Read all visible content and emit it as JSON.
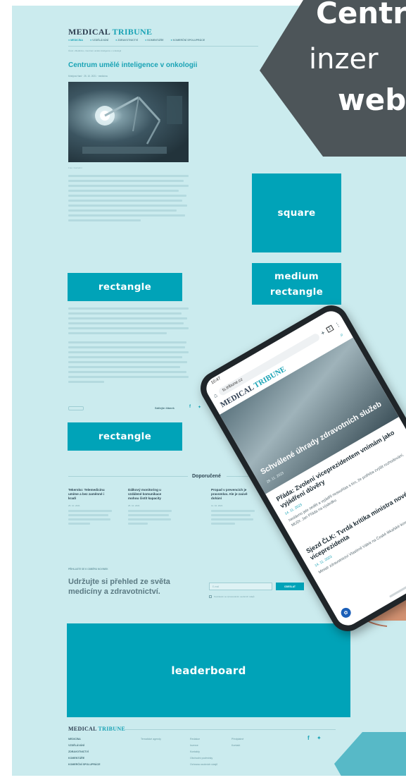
{
  "site": {
    "logo_part1": "MEDICAL",
    "logo_part2": "TRIBUNE",
    "nav": [
      "MEDICÍNA",
      "VZDĚLÁVÁNÍ",
      "ZDRAVOTNICTVÍ",
      "KOMENTÁŘE",
      "KOMERČNÍ SPOLUPRÁCE"
    ]
  },
  "article": {
    "breadcrumb": "Úvod › Medicína › Centrum umělé inteligence v onkologii",
    "title": "Centrum umělé inteligence v onkologii",
    "meta": "Kristýna Hard · 25. 10. 2021 · medicína",
    "share_label": "Sdílejte článek"
  },
  "ads": {
    "square": "square",
    "medium_rectangle": "medium rectangle",
    "rectangle_1": "rectangle",
    "rectangle_2": "rectangle",
    "leaderboard": "leaderboard"
  },
  "banner": {
    "line1": "Centr",
    "line2": "inzer",
    "line3": "web"
  },
  "recommended": {
    "heading": "Doporučené",
    "items": [
      {
        "title": "Tekersko: Telemedicínu umíme a bez zaměnné i kradí",
        "date": "25. 10. 2021"
      },
      {
        "title": "Dálkový monitoring u vzdálené komunikace mohou čistit kapacity",
        "date": "25. 10. 2021"
      },
      {
        "title": "Propad v prevencích je pravomluv. Ale je zaúvě dohání",
        "date": "11. 10. 2021"
      }
    ]
  },
  "newsletter": {
    "kicker": "PŘIHLASTE SE K ODBĚRU NOVINEK",
    "heading_line1": "Udržujte si přehled ze světa",
    "heading_line2": "medicíny a zdravotnictví.",
    "email_placeholder": "E-mail",
    "button": "ODESLAT",
    "consent": "Souhlasím se zpracováním osobních údajů"
  },
  "footer": {
    "logo_part1": "MEDICAL",
    "logo_part2": "TRIBUNE",
    "col1": [
      "MEDICÍNA",
      "VZDĚLÁVÁNÍ",
      "ZDRAVOTNICTVÍ",
      "KOMENTÁŘE",
      "KOMERČNÍ SPOLUPRÁCE"
    ],
    "col2": [
      "Tematické agendy"
    ],
    "col3": [
      "Redakce",
      "Inzerce",
      "Kontakty",
      "Obchodní podmínky",
      "Ochrana osobních údajů"
    ],
    "col4": [
      "Předplatné",
      "Kontakt"
    ]
  },
  "phone": {
    "url": "ts.tribune.cz",
    "tabs_count": "1",
    "logo_part1": "MEDICAL",
    "logo_part2": "TRIBUNE",
    "hero_caption": "Schválené úhrady zdravotních služeb",
    "hero_date": "29. 11. 2023",
    "news": [
      {
        "title": "Přáda: Zvolení viceprezidentem vnímám jako vyjádření důvěry",
        "date": "14. 11. 2023",
        "text": "Nedávno jste sedět a vyjádřil nesouhlas s tím, že potřeba zvýšit rozhodování, MUDr. Jan Přáda na výsledku"
      },
      {
        "title": "Sjezd ČLK: Tvrdá kritika ministra nového viceprezidenta",
        "date": "14. 11. 2023",
        "text": "Ministr zdravotnictví Vlastimil Válek na České lékařské komory kritizoval"
      }
    ]
  },
  "colors": {
    "page_bg": "#cbebee",
    "accent": "#00a3b8",
    "banner_dark": "#4d5559",
    "text_dark": "#2d4552"
  }
}
